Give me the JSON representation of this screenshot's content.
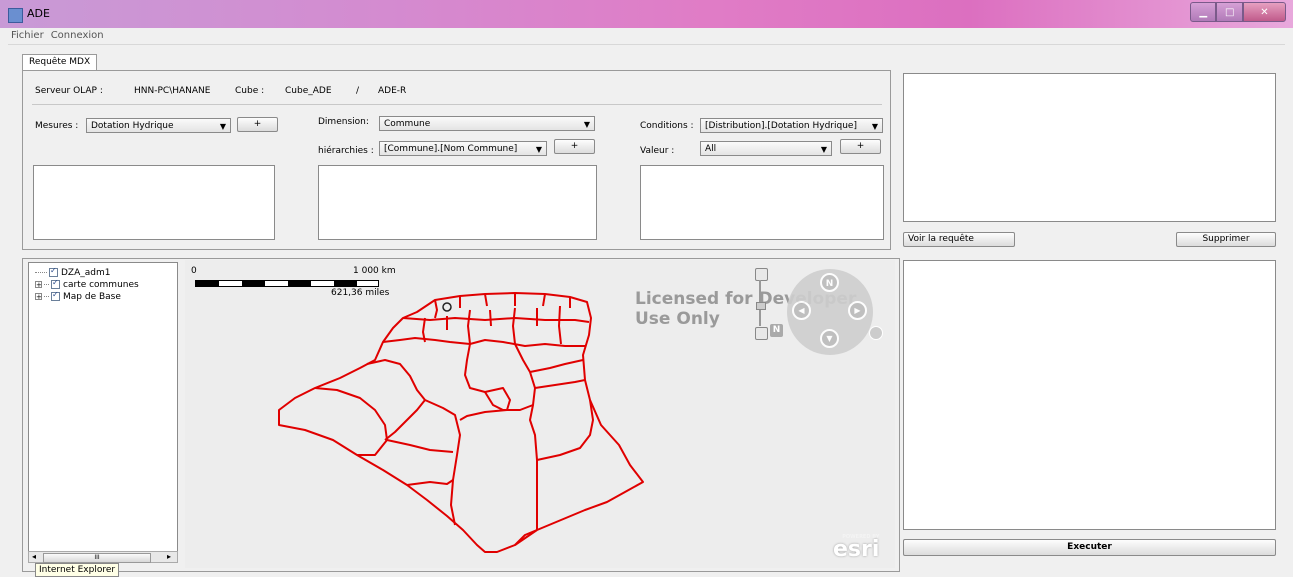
{
  "window": {
    "title": "ADE"
  },
  "menu": {
    "items": [
      "Fichier",
      "Connexion"
    ]
  },
  "tab": {
    "label": "Requête MDX"
  },
  "server": {
    "olap_label": "Serveur OLAP :",
    "olap_value": "HNN-PC\\HANANE",
    "cube_label": "Cube :",
    "cube_value": "Cube_ADE",
    "separator": "/",
    "cube_value2": "ADE-R"
  },
  "mesures": {
    "label": "Mesures :",
    "selected": "Dotation Hydrique",
    "add": "+"
  },
  "dimension": {
    "label": "Dimension:",
    "selected": "Commune"
  },
  "hierarchies": {
    "label": "hiérarchies :",
    "selected": "[Commune].[Nom Commune]",
    "add": "+"
  },
  "conditions": {
    "label": "Conditions :",
    "selected": "[Distribution].[Dotation Hydrique]"
  },
  "valeur": {
    "label": "Valeur :",
    "selected": "All",
    "add": "+"
  },
  "query": {
    "view_button": "Voir la requête",
    "delete_button": "Supprimer",
    "execute_button": "Executer"
  },
  "tree": {
    "items": [
      "DZA_adm1",
      "carte communes",
      "Map de Base"
    ]
  },
  "map": {
    "scale_zero": "0",
    "scale_km": "1 000 km",
    "scale_miles": "621,36 miles",
    "license_line1": "Licensed for Developer",
    "license_line2": "Use Only",
    "powered_by": "POWERED BY",
    "esri": "esri",
    "nav_north": "N",
    "border_color": "#e00000"
  },
  "scrollbar": {
    "thumb": "III"
  },
  "tooltip": {
    "text": "Internet Explorer"
  }
}
